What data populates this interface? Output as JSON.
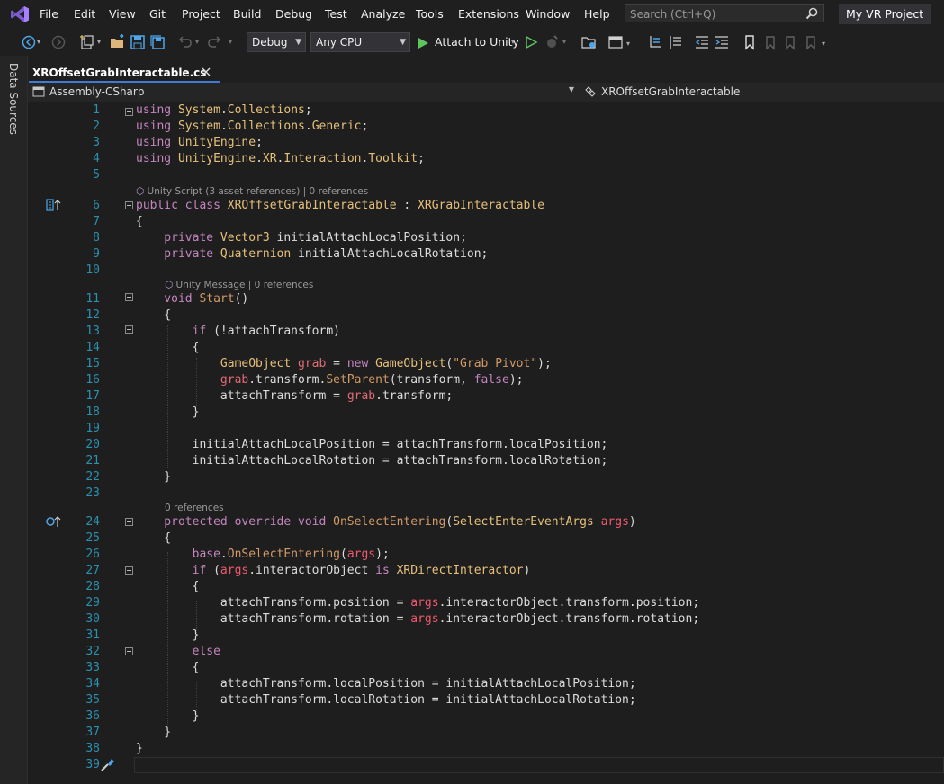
{
  "menu": [
    "File",
    "Edit",
    "View",
    "Git",
    "Project",
    "Build",
    "Debug",
    "Test",
    "Analyze",
    "Tools",
    "Extensions",
    "Window",
    "Help"
  ],
  "search": {
    "placeholder": "Search (Ctrl+Q)"
  },
  "project_title": "My VR Project",
  "toolbar": {
    "configuration": "Debug",
    "platform": "Any CPU",
    "attach_label": "Attach to Unity"
  },
  "side_panel": {
    "label": "Data Sources"
  },
  "tab": {
    "label": "XROffsetGrabInteractable.cs"
  },
  "nav": {
    "project": "Assembly-CSharp",
    "class": "XROffsetGrabInteractable"
  },
  "codelens": {
    "class": "Unity Script (3 asset references) | 0 references",
    "start": "Unity Message | 0 references",
    "override": "0 references"
  },
  "lines": [
    {
      "n": "1",
      "segs": [
        [
          "vs-key",
          "using "
        ],
        [
          "vs-ns",
          "System"
        ],
        [
          "vs-ident",
          "."
        ],
        [
          "vs-ns",
          "Collections"
        ],
        [
          "vs-ident",
          ";"
        ]
      ]
    },
    {
      "n": "2",
      "segs": [
        [
          "vs-key",
          "using "
        ],
        [
          "vs-ns",
          "System"
        ],
        [
          "vs-ident",
          "."
        ],
        [
          "vs-ns",
          "Collections"
        ],
        [
          "vs-ident",
          "."
        ],
        [
          "vs-ns",
          "Generic"
        ],
        [
          "vs-ident",
          ";"
        ]
      ]
    },
    {
      "n": "3",
      "segs": [
        [
          "vs-key",
          "using "
        ],
        [
          "vs-ns",
          "UnityEngine"
        ],
        [
          "vs-ident",
          ";"
        ]
      ]
    },
    {
      "n": "4",
      "segs": [
        [
          "vs-key",
          "using "
        ],
        [
          "vs-ns",
          "UnityEngine"
        ],
        [
          "vs-ident",
          "."
        ],
        [
          "vs-ns",
          "XR"
        ],
        [
          "vs-ident",
          "."
        ],
        [
          "vs-ns",
          "Interaction"
        ],
        [
          "vs-ident",
          "."
        ],
        [
          "vs-ns",
          "Toolkit"
        ],
        [
          "vs-ident",
          ";"
        ]
      ]
    },
    {
      "n": "5",
      "segs": []
    },
    {
      "n": "6",
      "segs": [
        [
          "vs-key",
          "public class "
        ],
        [
          "vs-type",
          "XROffsetGrabInteractable"
        ],
        [
          "vs-ident",
          " : "
        ],
        [
          "vs-type",
          "XRGrabInteractable"
        ]
      ]
    },
    {
      "n": "7",
      "segs": [
        [
          "vs-ident",
          "{"
        ]
      ]
    },
    {
      "n": "8",
      "segs": [
        [
          "vs-key",
          "    private "
        ],
        [
          "vs-type",
          "Vector3"
        ],
        [
          "vs-ident",
          " initialAttachLocalPosition;"
        ]
      ]
    },
    {
      "n": "9",
      "segs": [
        [
          "vs-key",
          "    private "
        ],
        [
          "vs-type",
          "Quaternion"
        ],
        [
          "vs-ident",
          " initialAttachLocalRotation;"
        ]
      ]
    },
    {
      "n": "10",
      "segs": []
    },
    {
      "n": "11",
      "segs": [
        [
          "vs-key",
          "    void "
        ],
        [
          "vs-method",
          "Start"
        ],
        [
          "vs-ident",
          "()"
        ]
      ]
    },
    {
      "n": "12",
      "segs": [
        [
          "vs-ident",
          "    {"
        ]
      ]
    },
    {
      "n": "13",
      "segs": [
        [
          "vs-key",
          "        if "
        ],
        [
          "vs-ident",
          "(!attachTransform)"
        ]
      ]
    },
    {
      "n": "14",
      "segs": [
        [
          "vs-ident",
          "        {"
        ]
      ]
    },
    {
      "n": "15",
      "segs": [
        [
          "vs-type",
          "            GameObject"
        ],
        [
          "vs-ident",
          " "
        ],
        [
          "vs-local",
          "grab"
        ],
        [
          "vs-ident",
          " = "
        ],
        [
          "vs-key",
          "new "
        ],
        [
          "vs-type",
          "GameObject"
        ],
        [
          "vs-ident",
          "("
        ],
        [
          "vs-method",
          "\"Grab Pivot\""
        ],
        [
          "vs-ident",
          ");"
        ]
      ]
    },
    {
      "n": "16",
      "segs": [
        [
          "vs-local",
          "            grab"
        ],
        [
          "vs-ident",
          ".transform."
        ],
        [
          "vs-method",
          "SetParent"
        ],
        [
          "vs-ident",
          "(transform, "
        ],
        [
          "vs-key",
          "false"
        ],
        [
          "vs-ident",
          ");"
        ]
      ]
    },
    {
      "n": "17",
      "segs": [
        [
          "vs-ident",
          "            attachTransform = "
        ],
        [
          "vs-local",
          "grab"
        ],
        [
          "vs-ident",
          ".transform;"
        ]
      ]
    },
    {
      "n": "18",
      "segs": [
        [
          "vs-ident",
          "        }"
        ]
      ]
    },
    {
      "n": "19",
      "segs": []
    },
    {
      "n": "20",
      "segs": [
        [
          "vs-ident",
          "        initialAttachLocalPosition = attachTransform.localPosition;"
        ]
      ]
    },
    {
      "n": "21",
      "segs": [
        [
          "vs-ident",
          "        initialAttachLocalRotation = attachTransform.localRotation;"
        ]
      ]
    },
    {
      "n": "22",
      "segs": [
        [
          "vs-ident",
          "    }"
        ]
      ]
    },
    {
      "n": "23",
      "segs": []
    },
    {
      "n": "24",
      "segs": [
        [
          "vs-key",
          "    protected override void "
        ],
        [
          "vs-method",
          "OnSelectEntering"
        ],
        [
          "vs-ident",
          "("
        ],
        [
          "vs-type",
          "SelectEnterEventArgs"
        ],
        [
          "vs-ident",
          " "
        ],
        [
          "vs-param",
          "args"
        ],
        [
          "vs-ident",
          ")"
        ]
      ]
    },
    {
      "n": "25",
      "segs": [
        [
          "vs-ident",
          "    {"
        ]
      ]
    },
    {
      "n": "26",
      "segs": [
        [
          "vs-key",
          "        base"
        ],
        [
          "vs-ident",
          "."
        ],
        [
          "vs-method",
          "OnSelectEntering"
        ],
        [
          "vs-ident",
          "("
        ],
        [
          "vs-param",
          "args"
        ],
        [
          "vs-ident",
          ");"
        ]
      ]
    },
    {
      "n": "27",
      "segs": [
        [
          "vs-key",
          "        if "
        ],
        [
          "vs-ident",
          "("
        ],
        [
          "vs-param",
          "args"
        ],
        [
          "vs-ident",
          ".interactorObject "
        ],
        [
          "vs-key",
          "is "
        ],
        [
          "vs-type",
          "XRDirectInteractor"
        ],
        [
          "vs-ident",
          ")"
        ]
      ]
    },
    {
      "n": "28",
      "segs": [
        [
          "vs-ident",
          "        {"
        ]
      ]
    },
    {
      "n": "29",
      "segs": [
        [
          "vs-ident",
          "            attachTransform.position = "
        ],
        [
          "vs-param",
          "args"
        ],
        [
          "vs-ident",
          ".interactorObject.transform.position;"
        ]
      ]
    },
    {
      "n": "30",
      "segs": [
        [
          "vs-ident",
          "            attachTransform.rotation = "
        ],
        [
          "vs-param",
          "args"
        ],
        [
          "vs-ident",
          ".interactorObject.transform.rotation;"
        ]
      ]
    },
    {
      "n": "31",
      "segs": [
        [
          "vs-ident",
          "        }"
        ]
      ]
    },
    {
      "n": "32",
      "segs": [
        [
          "vs-key",
          "        else"
        ]
      ]
    },
    {
      "n": "33",
      "segs": [
        [
          "vs-ident",
          "        {"
        ]
      ]
    },
    {
      "n": "34",
      "segs": [
        [
          "vs-ident",
          "            attachTransform.localPosition = initialAttachLocalPosition;"
        ]
      ]
    },
    {
      "n": "35",
      "segs": [
        [
          "vs-ident",
          "            attachTransform.localRotation = initialAttachLocalRotation;"
        ]
      ]
    },
    {
      "n": "36",
      "segs": [
        [
          "vs-ident",
          "        }"
        ]
      ]
    },
    {
      "n": "37",
      "segs": [
        [
          "vs-ident",
          "    }"
        ]
      ]
    },
    {
      "n": "38",
      "segs": [
        [
          "vs-ident",
          "}"
        ]
      ]
    },
    {
      "n": "39",
      "segs": []
    }
  ],
  "colors": {
    "accent": "#3f7bd6",
    "line_number": "#2b91af",
    "keyword": "#c586c0",
    "type": "#e6c07b",
    "method": "#d19a66",
    "parameter": "#ef596f"
  }
}
